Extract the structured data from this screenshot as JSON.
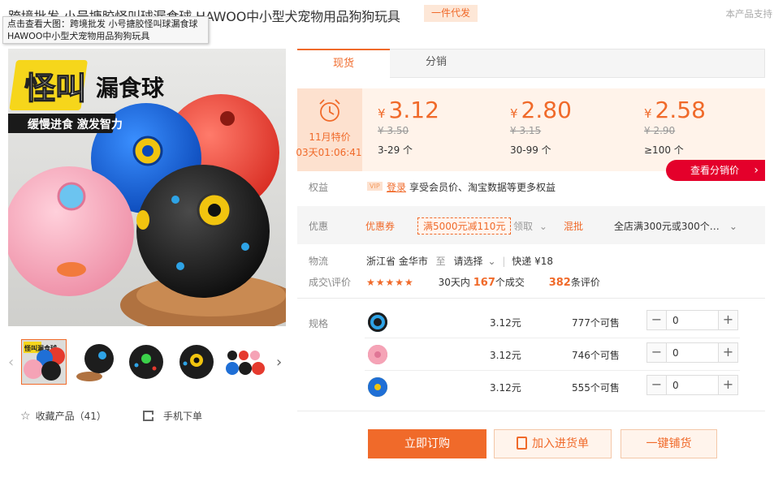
{
  "header": {
    "title": "跨境批发 小号搪胶怪叫球漏食球 HAWOO中小型犬宠物用品狗狗玩具",
    "tag": "一件代发",
    "support": "本产品支持"
  },
  "tooltip": {
    "line1": "点击查看大图：跨境批发 小号搪胶怪叫球漏食球",
    "line2": "HAWOO中小型犬宠物用品狗狗玩具"
  },
  "product_image": {
    "logo_text": "怪叫",
    "title_text": "漏食球",
    "slogan": "缓慢进食 激发智力"
  },
  "thumbnails": {
    "arrow_left": "‹",
    "arrow_right": "›",
    "mini_label": "怪叫漏食球"
  },
  "side_actions": {
    "favorite_label": "收藏产品（41）",
    "mobile_label": "手机下单"
  },
  "tabs": [
    {
      "label": "现货"
    },
    {
      "label": "分销"
    }
  ],
  "sale": {
    "title": "11月特价",
    "countdown": "03天01:06:41"
  },
  "prices": [
    {
      "yen": "¥",
      "now": "3.12",
      "old": "¥ 3.50",
      "range": "3-29 个"
    },
    {
      "yen": "¥",
      "now": "2.80",
      "old": "¥ 3.15",
      "range": "30-99 个"
    },
    {
      "yen": "¥",
      "now": "2.58",
      "old": "¥ 2.90",
      "range": "≥100 个"
    }
  ],
  "view_distribution": {
    "label": "查看分销价",
    "arrow": "›"
  },
  "benefits": {
    "label": "权益",
    "vip": "VIP",
    "login": "登录",
    "text": "享受会员价、淘宝数据等更多权益"
  },
  "discount": {
    "label": "优惠",
    "coupon_label": "优惠券",
    "coupon_value": "满5000元减110元",
    "claim": "领取",
    "mix_label": "混批",
    "mix_text": "全店满300元或300个…"
  },
  "logistics": {
    "label": "物流",
    "origin": "浙江省 金华市",
    "to": "至",
    "select": "请选择",
    "shipping": "快递 ¥18"
  },
  "sales": {
    "label": "成交\\评价",
    "stars": "★★★★★",
    "prefix": "30天内",
    "count": "167",
    "unit": "个成交",
    "reviews": "382",
    "reviews_unit": "条评价"
  },
  "spec": {
    "label": "规格",
    "rows": [
      {
        "color": "#1d1d1d",
        "price": "3.12元",
        "stock": "777个可售",
        "qty": "0"
      },
      {
        "color": "#f5a3b6",
        "price": "3.12元",
        "stock": "746个可售",
        "qty": "0"
      },
      {
        "color": "#1f6fd6",
        "price": "3.12元",
        "stock": "555个可售",
        "qty": "0"
      }
    ],
    "minus": "−",
    "plus": "+"
  },
  "buttons": {
    "order": "立即订购",
    "cart": "加入进货单",
    "onekey": "一键铺货"
  }
}
